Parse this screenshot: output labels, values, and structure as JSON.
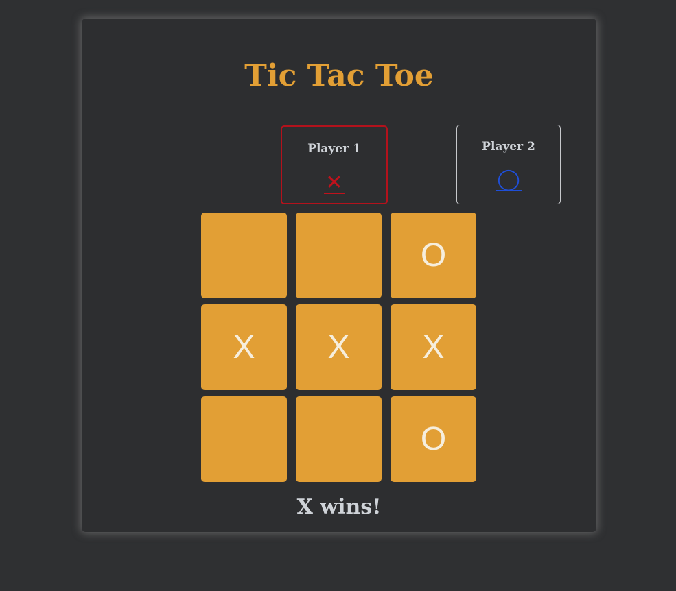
{
  "game": {
    "title": "Tic Tac Toe",
    "status": "X wins!"
  },
  "players": [
    {
      "label": "Player 1",
      "symbol": "✕",
      "color": "#c0121c",
      "active": true
    },
    {
      "label": "Player 2",
      "symbol": "◯",
      "color": "#1f4fd8",
      "active": false
    }
  ],
  "board": [
    [
      "",
      "",
      "O"
    ],
    [
      "X",
      "X",
      "X"
    ],
    [
      "",
      "",
      "O"
    ]
  ],
  "colors": {
    "background": "#2f3032",
    "accent": "#e29f35",
    "cell_mark": "#f6eedd",
    "active_border": "#b3121c"
  }
}
